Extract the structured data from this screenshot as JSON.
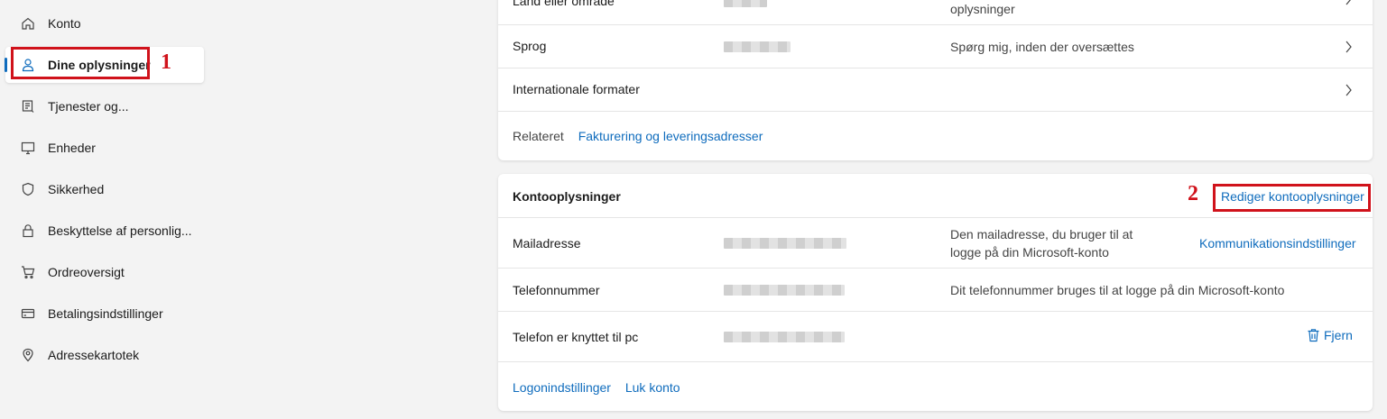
{
  "sidebar": {
    "items": [
      {
        "label": "Konto",
        "icon": "home-icon"
      },
      {
        "label": "Dine oplysninger",
        "icon": "person-icon"
      },
      {
        "label": "Tjenester og...",
        "icon": "document-list-icon"
      },
      {
        "label": "Enheder",
        "icon": "monitor-icon"
      },
      {
        "label": "Sikkerhed",
        "icon": "shield-icon"
      },
      {
        "label": "Beskyttelse af personlig...",
        "icon": "lock-icon"
      },
      {
        "label": "Ordreoversigt",
        "icon": "cart-icon"
      },
      {
        "label": "Betalingsindstillinger",
        "icon": "credit-card-icon"
      },
      {
        "label": "Adressekartotek",
        "icon": "location-pin-icon"
      }
    ]
  },
  "annotations": {
    "one": "1",
    "two": "2"
  },
  "region_card": {
    "rows": [
      {
        "label": "Land eller område",
        "desc": "oplysninger"
      },
      {
        "label": "Sprog",
        "desc": "Spørg mig, inden der oversættes"
      },
      {
        "label": "Internationale formater",
        "desc": ""
      }
    ],
    "related_label": "Relateret",
    "related_link": "Fakturering og leveringsadresser"
  },
  "account_card": {
    "title": "Kontooplysninger",
    "edit_link": "Rediger kontooplysninger",
    "rows": [
      {
        "label": "Mailadresse",
        "desc_line1": "Den mailadresse, du bruger til at",
        "desc_line2": "logge på din Microsoft-konto",
        "action": "Kommunikationsindstillinger"
      },
      {
        "label": "Telefonnummer",
        "desc": "Dit telefonnummer bruges til at logge på din Microsoft-konto"
      },
      {
        "label": "Telefon er knyttet til pc",
        "action": "Fjern"
      }
    ],
    "footer_links": [
      "Logonindstillinger",
      "Luk konto"
    ]
  },
  "colors": {
    "accent": "#0f6cbd",
    "highlight": "#d0121b",
    "background": "#f3f3f3"
  }
}
